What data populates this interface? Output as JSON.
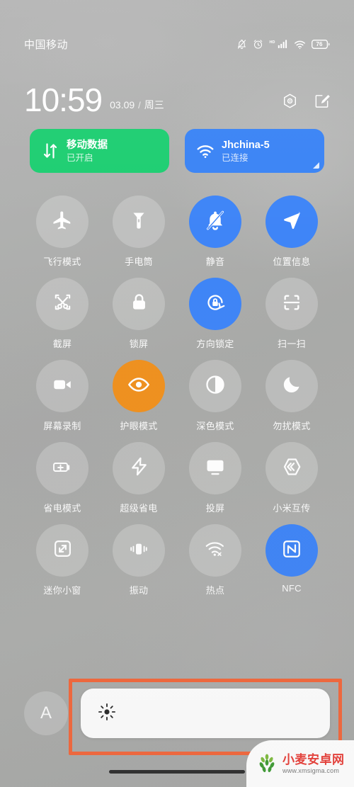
{
  "status_bar": {
    "carrier": "中国移动",
    "battery_level": "76",
    "icons": [
      "bell-mute-icon",
      "alarm-icon",
      "hd-signal-icon",
      "wifi-icon",
      "battery-icon"
    ]
  },
  "clock": {
    "time": "10:59",
    "date": "03.09",
    "separator": "/",
    "weekday": "周三",
    "settings_icon": "gear-hexagon-icon",
    "edit_icon": "edit-pencil-icon"
  },
  "connection_cards": [
    {
      "title": "移动数据",
      "subtitle": "已开启",
      "icon": "data-transfer-arrows-icon",
      "color": "#1ece72",
      "active": true
    },
    {
      "title": "Jhchina-5",
      "subtitle": "已连接",
      "icon": "wifi-icon",
      "color": "#3b84f5",
      "active": true
    }
  ],
  "toggles": [
    {
      "label": "飞行模式",
      "icon": "airplane-icon",
      "state": "off"
    },
    {
      "label": "手电筒",
      "icon": "flashlight-icon",
      "state": "off"
    },
    {
      "label": "静音",
      "icon": "bell-mute-icon",
      "state": "on-blue"
    },
    {
      "label": "位置信息",
      "icon": "location-arrow-icon",
      "state": "on-blue"
    },
    {
      "label": "截屏",
      "icon": "screenshot-scissors-icon",
      "state": "off"
    },
    {
      "label": "锁屏",
      "icon": "lock-icon",
      "state": "off"
    },
    {
      "label": "方向锁定",
      "icon": "rotation-lock-icon",
      "state": "on-blue"
    },
    {
      "label": "扫一扫",
      "icon": "scan-qr-icon",
      "state": "off"
    },
    {
      "label": "屏幕录制",
      "icon": "video-camera-icon",
      "state": "off"
    },
    {
      "label": "护眼模式",
      "icon": "eye-icon",
      "state": "on-orange"
    },
    {
      "label": "深色模式",
      "icon": "contrast-circle-icon",
      "state": "off"
    },
    {
      "label": "勿扰模式",
      "icon": "moon-icon",
      "state": "off"
    },
    {
      "label": "省电模式",
      "icon": "battery-plus-icon",
      "state": "off"
    },
    {
      "label": "超级省电",
      "icon": "lightning-bolt-icon",
      "state": "off"
    },
    {
      "label": "投屏",
      "icon": "cast-screen-icon",
      "state": "off"
    },
    {
      "label": "小米互传",
      "icon": "mi-share-icon",
      "state": "off"
    },
    {
      "label": "迷你小窗",
      "icon": "mini-window-icon",
      "state": "off"
    },
    {
      "label": "振动",
      "icon": "vibrate-icon",
      "state": "off"
    },
    {
      "label": "热点",
      "icon": "hotspot-icon",
      "state": "off"
    },
    {
      "label": "NFC",
      "icon": "nfc-icon",
      "state": "on-blue"
    }
  ],
  "brightness": {
    "auto_label": "A",
    "auto_icon": "auto-brightness-icon",
    "slider_icon": "sun-brightness-icon",
    "slider_percent": 100,
    "highlight_color": "#f2673c"
  },
  "watermark": {
    "title": "小麦安卓网",
    "url": "www.xmsigma.com",
    "logo": "wheat-logo-icon"
  },
  "colors": {
    "toggle_on_blue": "#3f85f7",
    "toggle_on_orange": "#f0911f",
    "toggle_off": "rgba(255,255,255,0.22)",
    "mobile_data_green": "#1ece72",
    "wifi_blue": "#3b84f5",
    "highlight_orange": "#f2673c"
  }
}
